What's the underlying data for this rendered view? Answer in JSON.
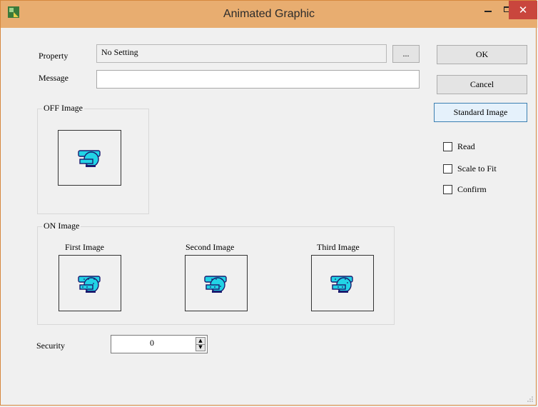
{
  "window": {
    "title": "Animated Graphic",
    "controls": {
      "minimize": "–",
      "maximize": "□",
      "close": "✕"
    }
  },
  "form": {
    "property_label": "Property",
    "property_value": "No Setting",
    "browse_label": "...",
    "message_label": "Message",
    "message_value": "",
    "security_label": "Security",
    "security_value": "0"
  },
  "buttons": {
    "ok": "OK",
    "cancel": "Cancel",
    "standard_image": "Standard Image"
  },
  "options": [
    {
      "label": "Read",
      "checked": false
    },
    {
      "label": "Scale to Fit",
      "checked": false
    },
    {
      "label": "Confirm",
      "checked": false
    }
  ],
  "off_group": {
    "title": "OFF Image",
    "icon": "pump-icon"
  },
  "on_group": {
    "title": "ON Image",
    "images": [
      {
        "label": "First Image",
        "icon": "pump-flow-icon"
      },
      {
        "label": "Second Image",
        "icon": "pump-flow-icon"
      },
      {
        "label": "Third Image",
        "icon": "pump-flow-icon"
      }
    ]
  },
  "colors": {
    "titlebar": "#e8ad70",
    "close": "#c9463d",
    "pump_fill": "#22d3e6",
    "pump_outline": "#1a1a6e"
  }
}
